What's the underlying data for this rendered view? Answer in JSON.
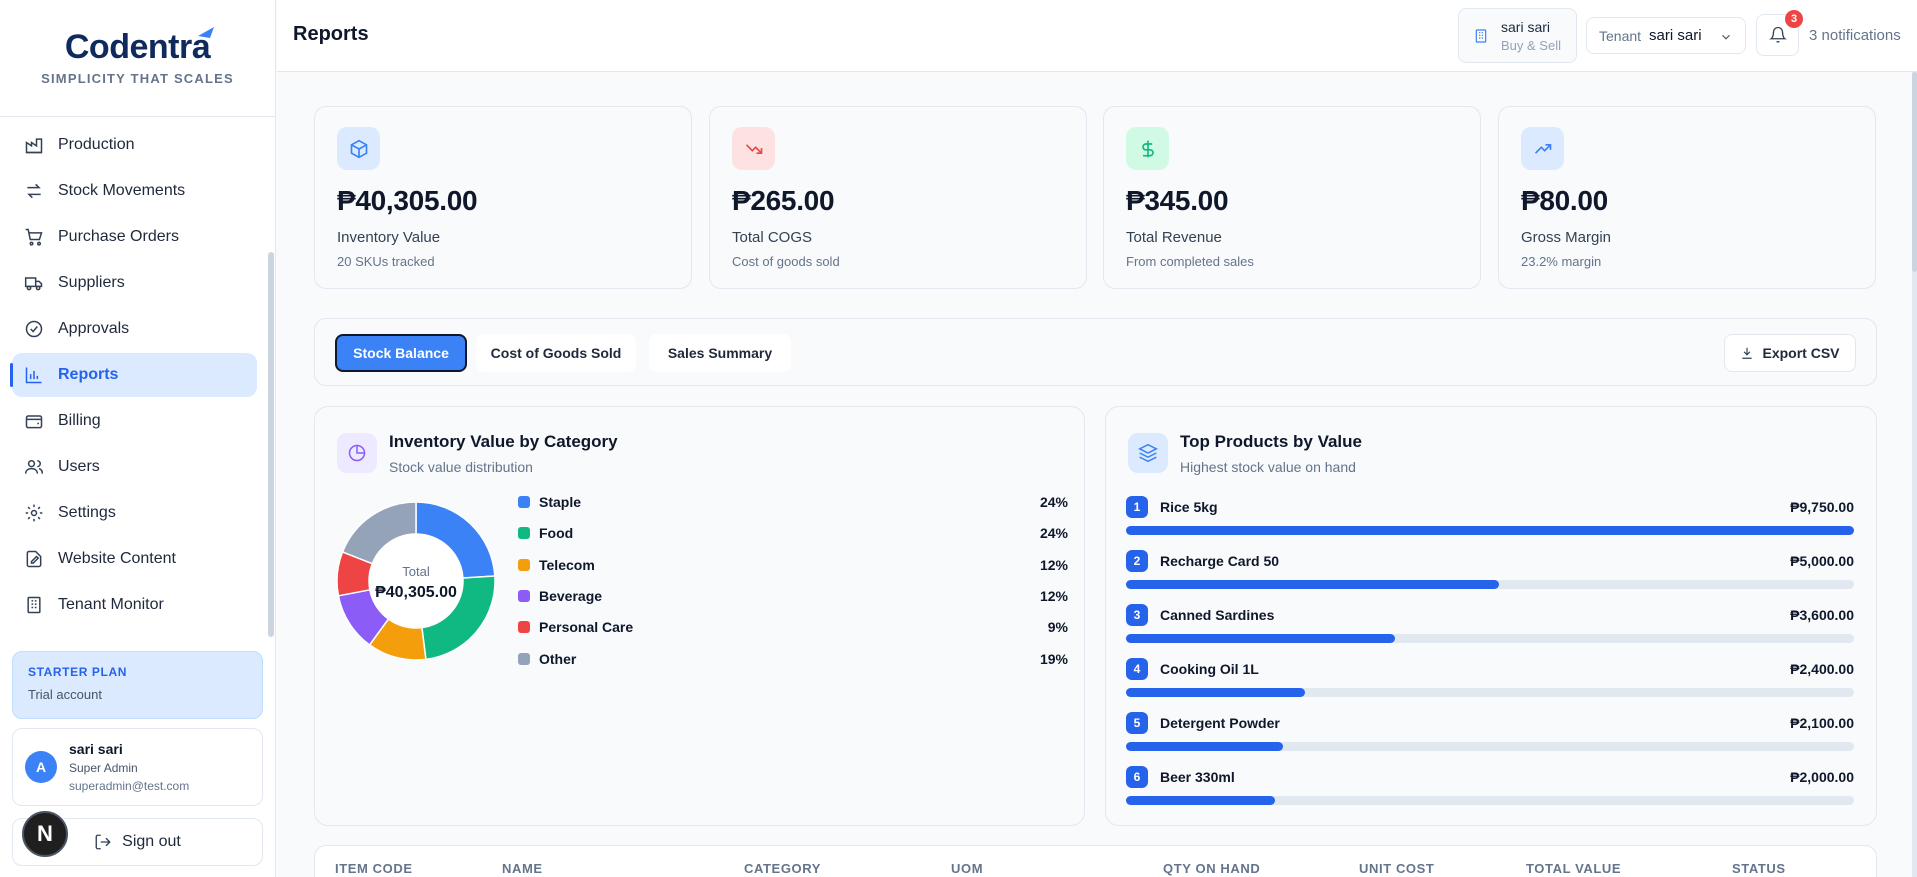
{
  "brand": {
    "name": "Codentra",
    "tagline": "SIMPLICITY THAT SCALES"
  },
  "sidebar": {
    "items": [
      {
        "label": "Production",
        "icon": "factory-icon"
      },
      {
        "label": "Stock Movements",
        "icon": "arrows-icon"
      },
      {
        "label": "Purchase Orders",
        "icon": "cart-icon"
      },
      {
        "label": "Suppliers",
        "icon": "truck-icon"
      },
      {
        "label": "Approvals",
        "icon": "check-circle-icon"
      },
      {
        "label": "Reports",
        "icon": "bar-chart-icon",
        "active": true
      },
      {
        "label": "Billing",
        "icon": "wallet-icon"
      },
      {
        "label": "Users",
        "icon": "users-icon"
      },
      {
        "label": "Settings",
        "icon": "gear-icon"
      },
      {
        "label": "Website Content",
        "icon": "edit-file-icon"
      },
      {
        "label": "Tenant Monitor",
        "icon": "building-icon"
      }
    ],
    "plan": {
      "title": "STARTER PLAN",
      "subtitle": "Trial account"
    },
    "user": {
      "initial": "A",
      "name": "sari sari",
      "role": "Super Admin",
      "email": "superadmin@test.com"
    },
    "signout": "Sign out",
    "dev_badge": "N"
  },
  "header": {
    "title": "Reports",
    "store": {
      "name": "sari sari",
      "subtitle": "Buy & Sell"
    },
    "tenant_label": "Tenant",
    "tenant_value": "sari sari",
    "notification_count": "3",
    "notification_text": "3 notifications"
  },
  "stats": [
    {
      "value": "₱40,305.00",
      "label": "Inventory Value",
      "sub": "20 SKUs tracked",
      "icon": "box-icon",
      "color": "#3b82f6",
      "bg": "#dbeafe"
    },
    {
      "value": "₱265.00",
      "label": "Total COGS",
      "sub": "Cost of goods sold",
      "icon": "trend-down-icon",
      "color": "#ef4444",
      "bg": "#fee2e2"
    },
    {
      "value": "₱345.00",
      "label": "Total Revenue",
      "sub": "From completed sales",
      "icon": "dollar-icon",
      "color": "#10b981",
      "bg": "#d1fae5"
    },
    {
      "value": "₱80.00",
      "label": "Gross Margin",
      "sub": "23.2% margin",
      "icon": "trend-up-icon",
      "color": "#3b82f6",
      "bg": "#dbeafe"
    }
  ],
  "tabs": [
    {
      "label": "Stock Balance",
      "active": true
    },
    {
      "label": "Cost of Goods Sold"
    },
    {
      "label": "Sales Summary"
    }
  ],
  "export_label": "Export CSV",
  "category_panel": {
    "title": "Inventory Value by Category",
    "subtitle": "Stock value distribution",
    "total_label": "Total",
    "total_value": "₱40,305.00"
  },
  "products_panel": {
    "title": "Top Products by Value",
    "subtitle": "Highest stock value on hand"
  },
  "chart_data": [
    {
      "type": "pie",
      "categories": [
        "Staple",
        "Food",
        "Telecom",
        "Beverage",
        "Personal Care",
        "Other"
      ],
      "values": [
        24,
        24,
        12,
        12,
        9,
        19
      ],
      "labels": [
        "24%",
        "24%",
        "12%",
        "12%",
        "9%",
        "19%"
      ],
      "colors": [
        "#3b82f6",
        "#10b981",
        "#f59e0b",
        "#8b5cf6",
        "#ef4444",
        "#94a3b8"
      ]
    },
    {
      "type": "bar",
      "categories": [
        "Rice 5kg",
        "Recharge Card 50",
        "Canned Sardines",
        "Cooking Oil 1L",
        "Detergent Powder",
        "Beer 330ml"
      ],
      "values": [
        9750,
        5000,
        3600,
        2400,
        2100,
        2000
      ],
      "labels": [
        "₱9,750.00",
        "₱5,000.00",
        "₱3,600.00",
        "₱2,400.00",
        "₱2,100.00",
        "₱2,000.00"
      ],
      "ranks": [
        "1",
        "2",
        "3",
        "4",
        "5",
        "6"
      ]
    }
  ],
  "table": {
    "columns": [
      "ITEM CODE",
      "NAME",
      "CATEGORY",
      "UOM",
      "QTY ON HAND",
      "UNIT COST",
      "TOTAL VALUE",
      "STATUS"
    ]
  }
}
